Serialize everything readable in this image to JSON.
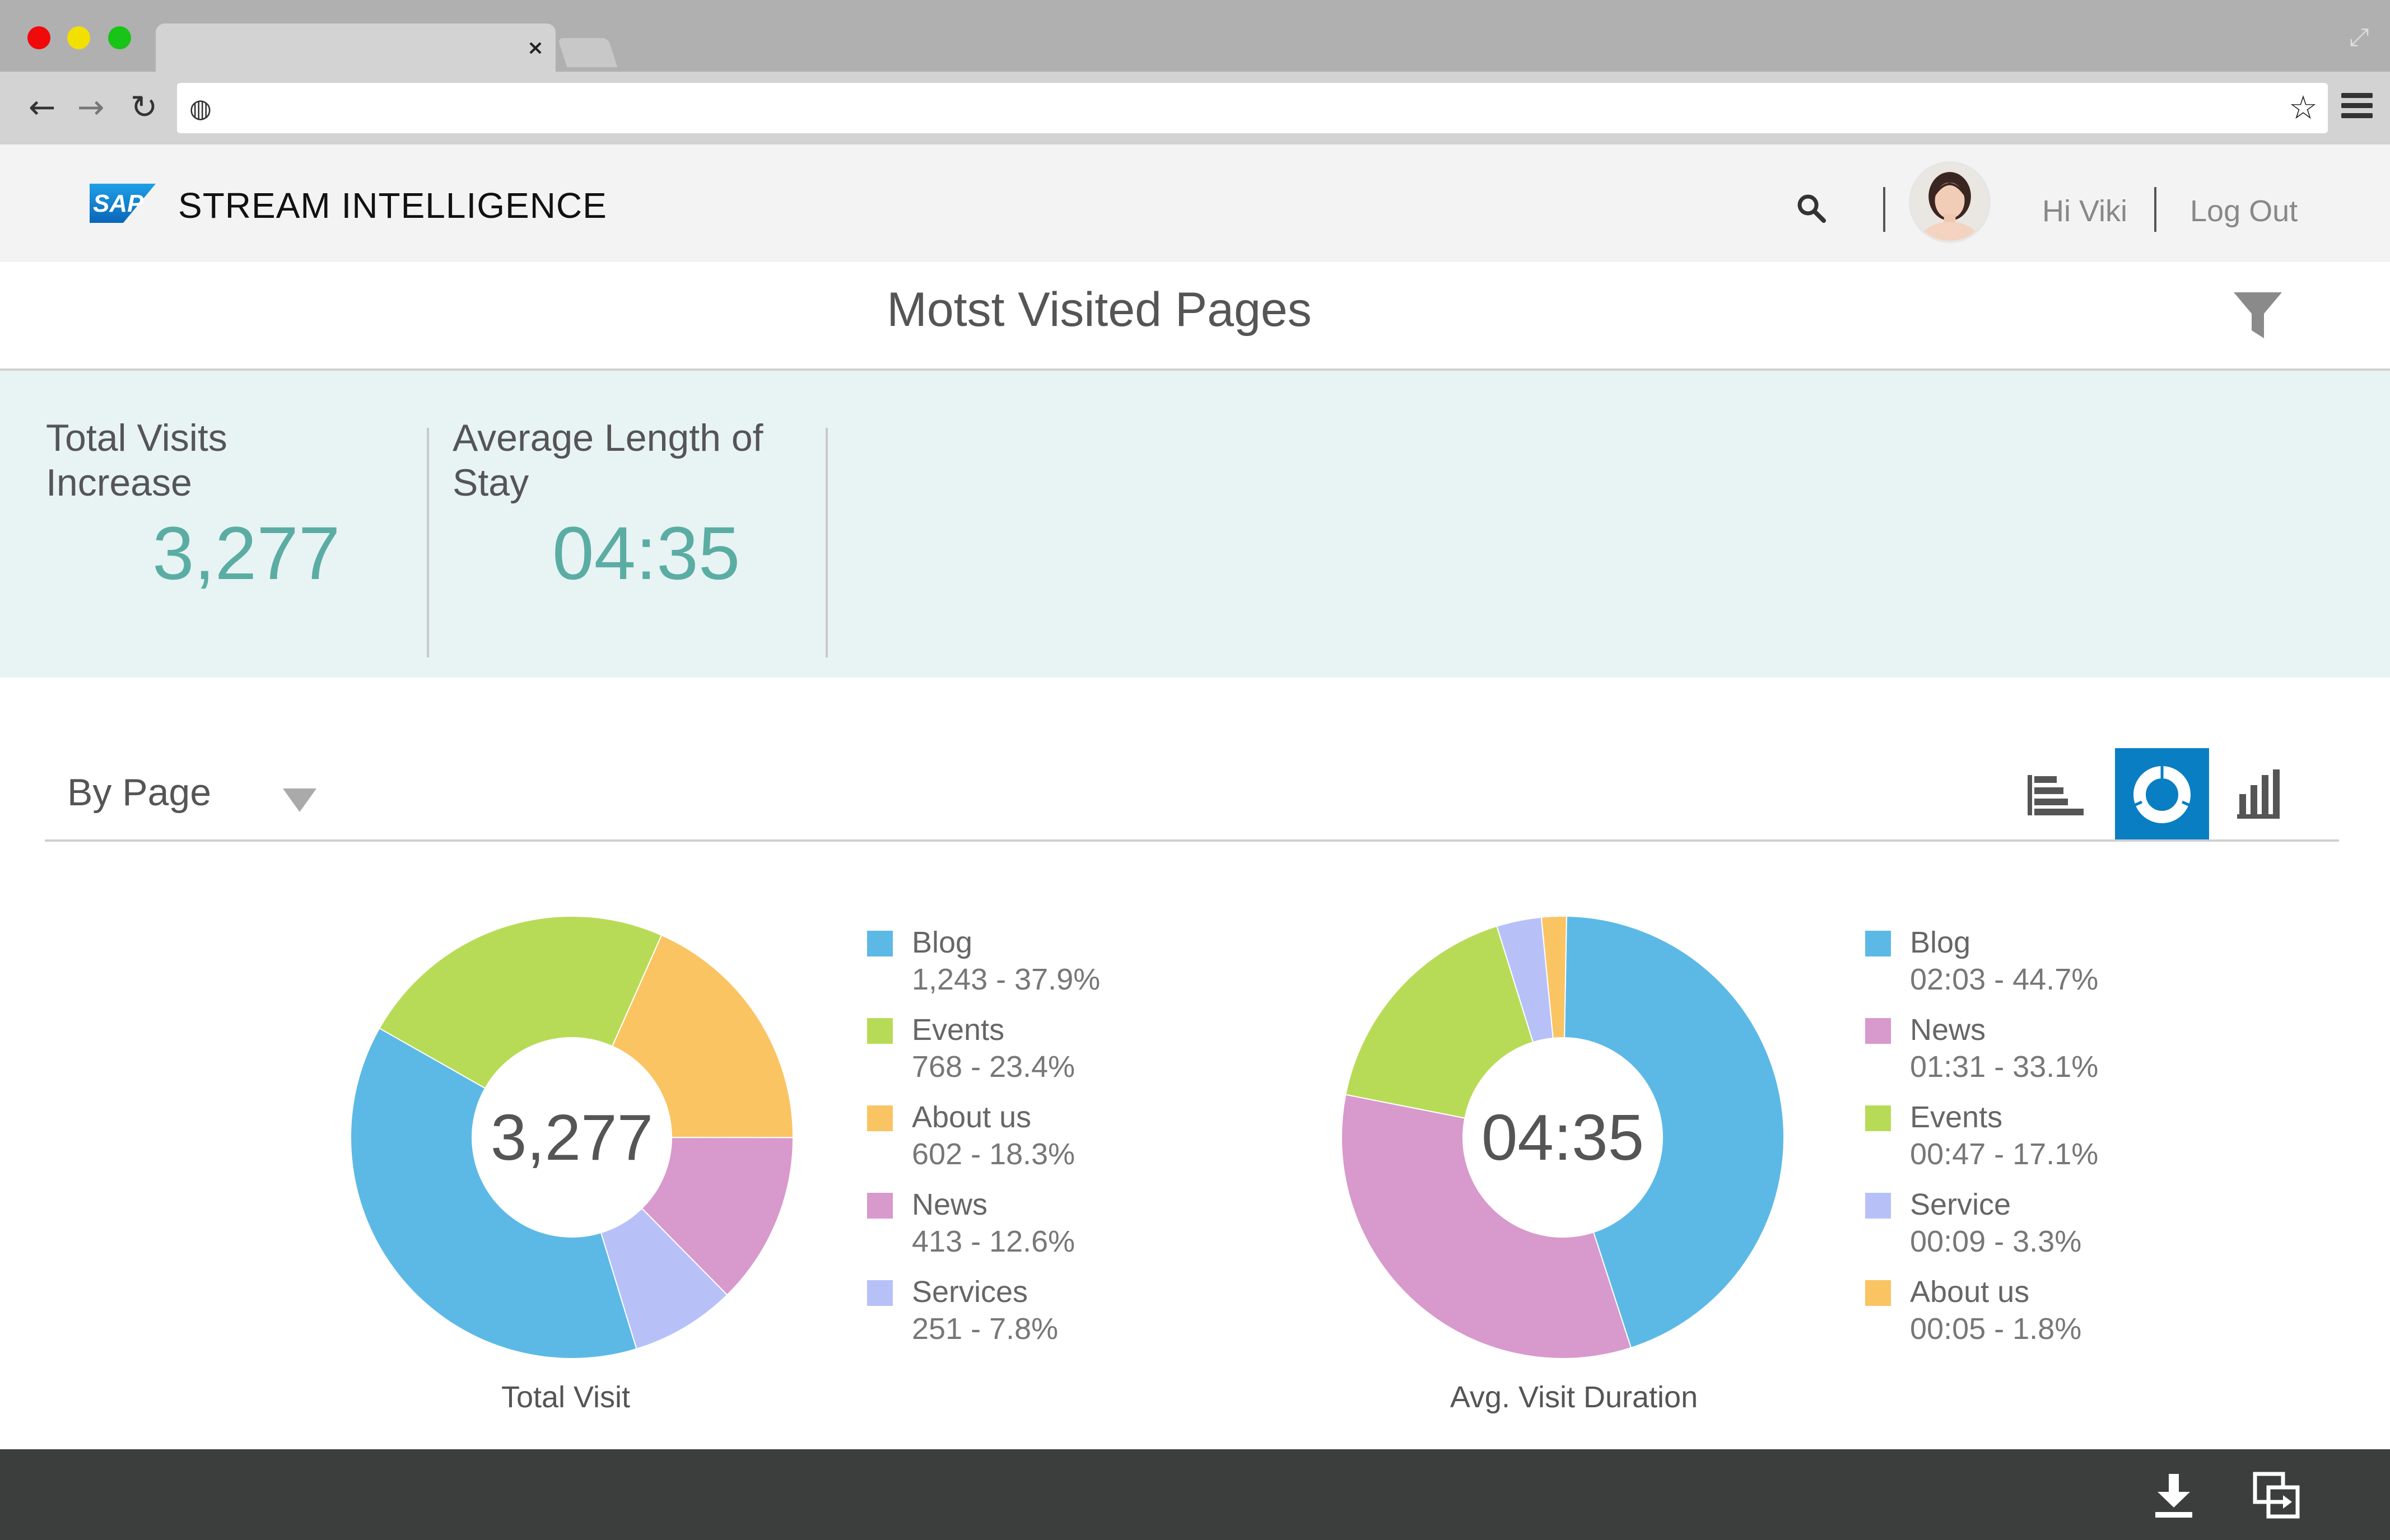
{
  "browser": {
    "tab_close": "×",
    "nav_back": "←",
    "nav_forward": "→",
    "nav_reload": "↻",
    "globe": "◍",
    "star": "☆",
    "resize": "⤢"
  },
  "header": {
    "logo_text": "SAP",
    "app_name": "STREAM INTELLIGENCE",
    "greeting": "Hi Viki",
    "logout": "Log Out"
  },
  "page": {
    "title": "Motst Visited Pages"
  },
  "kpis": [
    {
      "label": "Total Visits Increase",
      "value": "3,277"
    },
    {
      "label": "Average Length of Stay",
      "value": "04:35"
    }
  ],
  "controls": {
    "group_by": "By Page",
    "active_view": "donut"
  },
  "colors": {
    "accent": "#0a7ec2",
    "kpi_value": "#5bada4",
    "blog": "#5cb9e6",
    "events": "#b8db57",
    "about_us": "#fac463",
    "news": "#d899cc",
    "services": "#b7c1f8"
  },
  "chart_data": [
    {
      "type": "pie",
      "variant": "donut",
      "title": "Total Visit",
      "center_label": "3,277",
      "legend_position": "right",
      "slices": [
        {
          "label": "Blog",
          "value": 1243,
          "percent": 37.9,
          "display": "1,243 - 37.9%",
          "color": "#5cb9e6"
        },
        {
          "label": "Events",
          "value": 768,
          "percent": 23.4,
          "display": "768 - 23.4%",
          "color": "#b8db57"
        },
        {
          "label": "About us",
          "value": 602,
          "percent": 18.3,
          "display": "602 - 18.3%",
          "color": "#fac463"
        },
        {
          "label": "News",
          "value": 413,
          "percent": 12.6,
          "display": "413 - 12.6%",
          "color": "#d899cc"
        },
        {
          "label": "Services",
          "value": 251,
          "percent": 7.8,
          "display": "251 - 7.8%",
          "color": "#b7c1f8"
        }
      ]
    },
    {
      "type": "pie",
      "variant": "donut",
      "title": "Avg. Visit Duration",
      "center_label": "04:35",
      "legend_position": "right",
      "slices": [
        {
          "label": "Blog",
          "value": 123,
          "percent": 44.7,
          "display": "02:03 - 44.7%",
          "color": "#5cb9e6"
        },
        {
          "label": "News",
          "value": 91,
          "percent": 33.1,
          "display": "01:31 - 33.1%",
          "color": "#d899cc"
        },
        {
          "label": "Events",
          "value": 47,
          "percent": 17.1,
          "display": "00:47 - 17.1%",
          "color": "#b8db57"
        },
        {
          "label": "Service",
          "value": 9,
          "percent": 3.3,
          "display": "00:09 - 3.3%",
          "color": "#b7c1f8"
        },
        {
          "label": "About us",
          "value": 5,
          "percent": 1.8,
          "display": "00:05 - 1.8%",
          "color": "#fac463"
        }
      ]
    }
  ]
}
